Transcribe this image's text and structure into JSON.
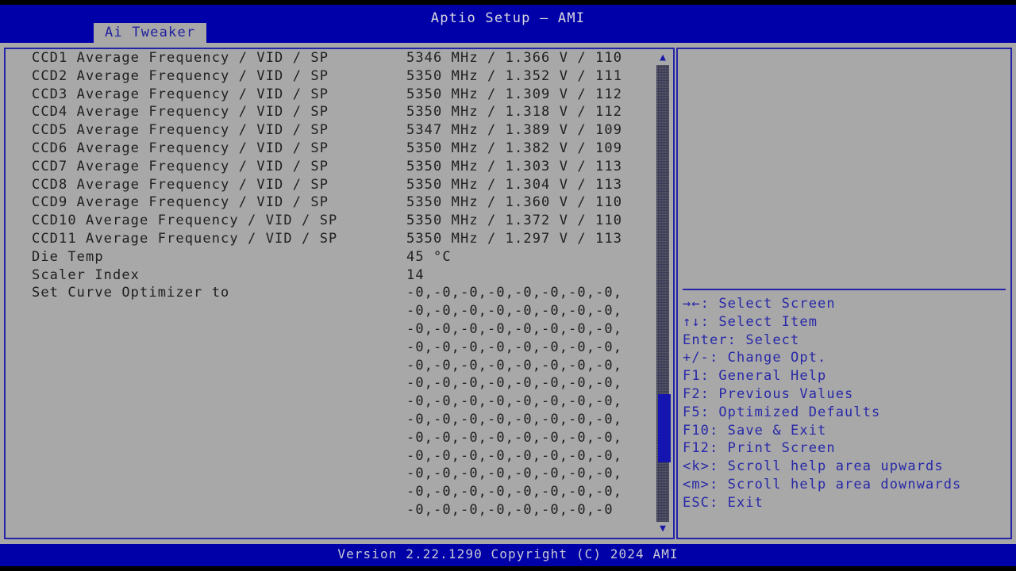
{
  "app": {
    "title": "Aptio Setup – AMI",
    "footer": "Version 2.22.1290 Copyright (C) 2024 AMI",
    "colors": {
      "header_blue": "#0000a8",
      "panel_gray": "#a8a8a8",
      "border_blue": "#2424a8",
      "help_text_blue": "#2828a8",
      "body_text": "#202020"
    }
  },
  "tabs": [
    {
      "label": "Ai Tweaker",
      "active": true
    }
  ],
  "settings": {
    "rows": [
      {
        "label": "CCD1 Average Frequency / VID / SP",
        "value": "5346 MHz / 1.366 V / 110"
      },
      {
        "label": "CCD2 Average Frequency / VID / SP",
        "value": "5350 MHz / 1.352 V / 111"
      },
      {
        "label": "CCD3 Average Frequency / VID / SP",
        "value": "5350 MHz / 1.309 V / 112"
      },
      {
        "label": "CCD4 Average Frequency / VID / SP",
        "value": "5350 MHz / 1.318 V / 112"
      },
      {
        "label": "CCD5 Average Frequency / VID / SP",
        "value": "5347 MHz / 1.389 V / 109"
      },
      {
        "label": "CCD6 Average Frequency / VID / SP",
        "value": "5350 MHz / 1.382 V / 109"
      },
      {
        "label": "CCD7 Average Frequency / VID / SP",
        "value": "5350 MHz / 1.303 V / 113"
      },
      {
        "label": "CCD8 Average Frequency / VID / SP",
        "value": "5350 MHz / 1.304 V / 113"
      },
      {
        "label": "CCD9 Average Frequency / VID / SP",
        "value": "5350 MHz / 1.360 V / 110"
      },
      {
        "label": "CCD10 Average Frequency / VID / SP",
        "value": "5350 MHz / 1.372 V / 110"
      },
      {
        "label": "CCD11 Average Frequency / VID / SP",
        "value": "5350 MHz / 1.297 V / 113"
      },
      {
        "label": "Die Temp",
        "value": "45 °C"
      },
      {
        "label": "Scaler Index",
        "value": "14"
      },
      {
        "label": "Set Curve Optimizer to",
        "value": "-0,-0,-0,-0,-0,-0,-0,-0,"
      },
      {
        "label": "",
        "value": "-0,-0,-0,-0,-0,-0,-0,-0,"
      },
      {
        "label": "",
        "value": "-0,-0,-0,-0,-0,-0,-0,-0,"
      },
      {
        "label": "",
        "value": "-0,-0,-0,-0,-0,-0,-0,-0,"
      },
      {
        "label": "",
        "value": "-0,-0,-0,-0,-0,-0,-0,-0,"
      },
      {
        "label": "",
        "value": "-0,-0,-0,-0,-0,-0,-0,-0,"
      },
      {
        "label": "",
        "value": "-0,-0,-0,-0,-0,-0,-0,-0,"
      },
      {
        "label": "",
        "value": "-0,-0,-0,-0,-0,-0,-0,-0,"
      },
      {
        "label": "",
        "value": "-0,-0,-0,-0,-0,-0,-0,-0,"
      },
      {
        "label": "",
        "value": "-0,-0,-0,-0,-0,-0,-0,-0,"
      },
      {
        "label": "",
        "value": "-0,-0,-0,-0,-0,-0,-0,-0,"
      },
      {
        "label": "",
        "value": "-0,-0,-0,-0,-0,-0,-0,-0,"
      },
      {
        "label": "",
        "value": "-0,-0,-0,-0,-0,-0,-0,-0"
      }
    ]
  },
  "scrollbar": {
    "up_arrow": "▲",
    "down_arrow": "▼",
    "thumb_top_pct": 72,
    "thumb_height_pct": 15
  },
  "help": {
    "items": [
      "→←: Select Screen",
      "↑↓: Select Item",
      "Enter: Select",
      "+/-: Change Opt.",
      "F1: General Help",
      "F2: Previous Values",
      "F5: Optimized Defaults",
      "F10: Save & Exit",
      "F12: Print Screen",
      "<k>: Scroll help area upwards",
      "<m>: Scroll help area downwards",
      "ESC: Exit"
    ]
  }
}
